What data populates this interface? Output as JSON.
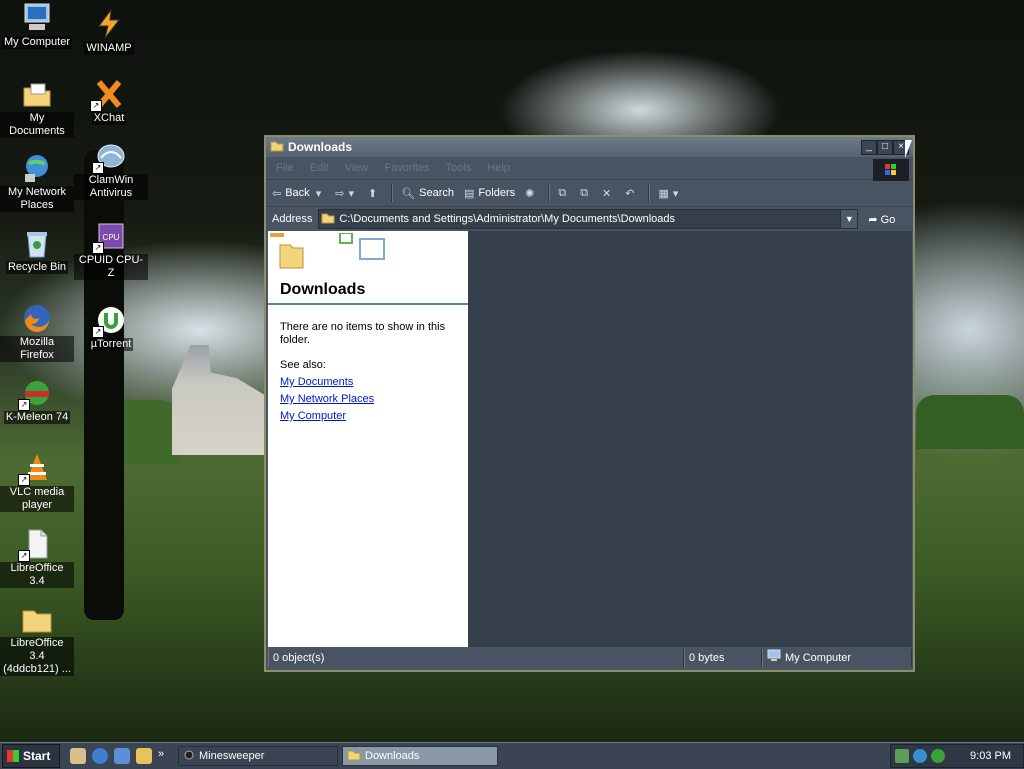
{
  "desktop": {
    "icons": [
      {
        "label": "My Computer",
        "icon": "computer-icon"
      },
      {
        "label": "WINAMP",
        "icon": "winamp-icon"
      },
      {
        "label": "My Documents",
        "icon": "documents-folder-icon"
      },
      {
        "label": "XChat",
        "icon": "xchat-icon"
      },
      {
        "label": "My Network Places",
        "icon": "network-icon"
      },
      {
        "label": "ClamWin Antivirus",
        "icon": "clamwin-icon"
      },
      {
        "label": "Recycle Bin",
        "icon": "recycle-bin-icon"
      },
      {
        "label": "CPUID CPU-Z",
        "icon": "cpuz-icon"
      },
      {
        "label": "Mozilla Firefox",
        "icon": "firefox-icon"
      },
      {
        "label": "µTorrent",
        "icon": "utorrent-icon"
      },
      {
        "label": "K-Meleon 74",
        "icon": "kmeleon-icon"
      },
      {
        "label": "VLC media player",
        "icon": "vlc-icon"
      },
      {
        "label": "LibreOffice 3.4",
        "icon": "libreoffice-icon"
      },
      {
        "label": "LibreOffice 3.4 (4ddcb121) ...",
        "icon": "folder-icon"
      }
    ]
  },
  "window": {
    "title": "Downloads",
    "menu": [
      "File",
      "Edit",
      "View",
      "Favorites",
      "Tools",
      "Help"
    ],
    "toolbar": {
      "back": "Back",
      "search": "Search",
      "folders": "Folders"
    },
    "address": {
      "label": "Address",
      "value": "C:\\Documents and Settings\\Administrator\\My Documents\\Downloads",
      "go": "Go"
    },
    "tasks": {
      "title": "Downloads",
      "empty_text": "There are no items to show in this folder.",
      "see_also": "See also:",
      "links": [
        "My Documents",
        "My Network Places",
        "My Computer"
      ]
    },
    "status": {
      "objects": "0 object(s)",
      "size": "0 bytes",
      "location": "My Computer"
    }
  },
  "taskbar": {
    "start": "Start",
    "buttons": [
      "Minesweeper",
      "Downloads"
    ],
    "clock": "9:03 PM"
  },
  "colors": {
    "link": "#0018c8",
    "window_bg": "#4a5664",
    "file_pane": "#36404c"
  }
}
